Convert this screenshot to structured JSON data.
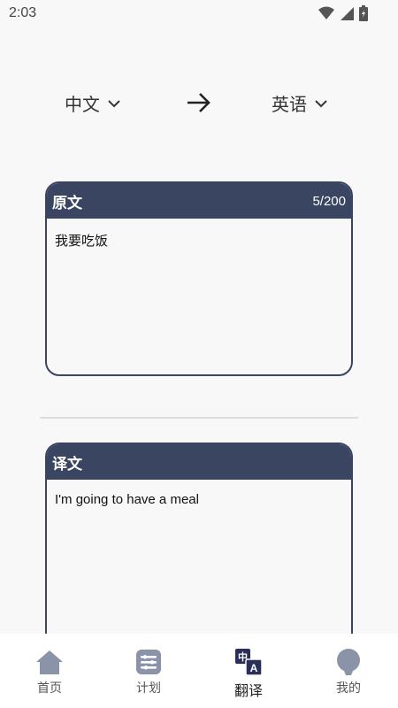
{
  "status": {
    "time": "2:03"
  },
  "languages": {
    "from": "中文",
    "to": "英语"
  },
  "source": {
    "title": "原文",
    "count": "5/200",
    "text": "我要吃饭"
  },
  "target": {
    "title": "译文",
    "text": "I'm going to have a meal"
  },
  "tabs": [
    {
      "label": "首页",
      "icon": "home-icon"
    },
    {
      "label": "计划",
      "icon": "plan-icon"
    },
    {
      "label": "翻译",
      "icon": "translate-icon",
      "active": true
    },
    {
      "label": "我的",
      "icon": "profile-icon"
    }
  ],
  "colors": {
    "header": "#3a4562",
    "icon_inactive": "#8a93a8",
    "icon_active": "#2a2f5a",
    "background": "#f8f8f8"
  }
}
